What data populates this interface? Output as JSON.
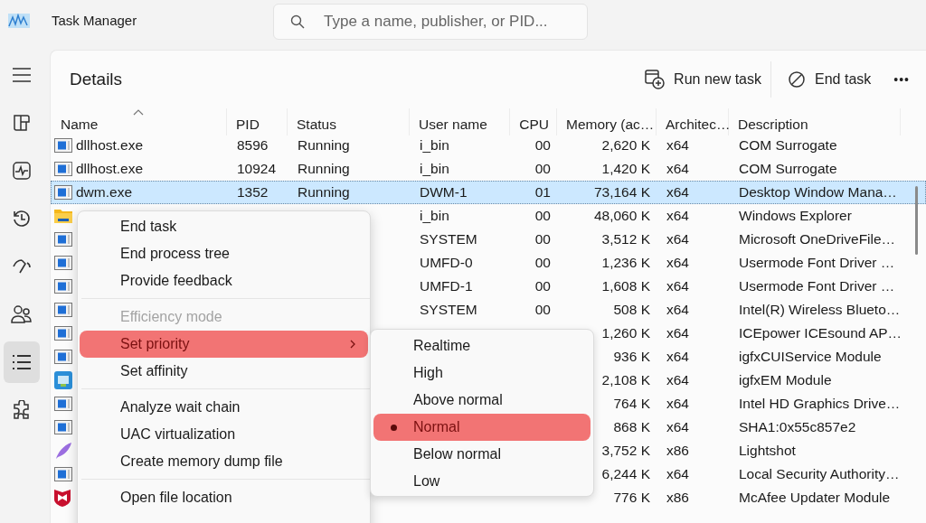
{
  "window": {
    "title": "Task Manager"
  },
  "search": {
    "placeholder": "Type a name, publisher, or PID..."
  },
  "sidebar": {
    "items": [
      {
        "kind": "menu",
        "selected": false
      },
      {
        "kind": "processes",
        "selected": false
      },
      {
        "kind": "performance",
        "selected": false
      },
      {
        "kind": "history",
        "selected": false
      },
      {
        "kind": "startup",
        "selected": false
      },
      {
        "kind": "users",
        "selected": false
      },
      {
        "kind": "details",
        "selected": true
      },
      {
        "kind": "services",
        "selected": false
      }
    ]
  },
  "header": {
    "title": "Details",
    "actions": [
      {
        "kind": "run",
        "label": "Run new task"
      },
      {
        "kind": "end",
        "label": "End task"
      },
      {
        "kind": "more",
        "label": "•••"
      }
    ]
  },
  "table": {
    "columns": [
      {
        "label": "Name",
        "sorted": true
      },
      {
        "label": "PID",
        "sorted": false
      },
      {
        "label": "Status",
        "sorted": false
      },
      {
        "label": "User name",
        "sorted": false
      },
      {
        "label": "CPU",
        "sorted": false
      },
      {
        "label": "Memory (ac…",
        "sorted": false
      },
      {
        "label": "Architec…",
        "sorted": false
      },
      {
        "label": "Description",
        "sorted": false
      }
    ],
    "rows": [
      {
        "kind": "exe",
        "selected": false,
        "cells": [
          "dllhost.exe",
          "8596",
          "Running",
          "i_bin",
          "00",
          "2,620 K",
          "x64",
          "COM Surrogate"
        ]
      },
      {
        "kind": "exe",
        "selected": false,
        "cells": [
          "dllhost.exe",
          "10924",
          "Running",
          "i_bin",
          "00",
          "1,420 K",
          "x64",
          "COM Surrogate"
        ]
      },
      {
        "kind": "exe",
        "selected": true,
        "cells": [
          "dwm.exe",
          "1352",
          "Running",
          "DWM-1",
          "01",
          "73,164 K",
          "x64",
          "Desktop Window Mana…"
        ]
      },
      {
        "kind": "folder",
        "selected": false,
        "cells": [
          null,
          null,
          null,
          "i_bin",
          "00",
          "48,060 K",
          "x64",
          "Windows Explorer"
        ]
      },
      {
        "kind": "exe",
        "selected": false,
        "cells": [
          null,
          null,
          null,
          "SYSTEM",
          "00",
          "3,512 K",
          "x64",
          "Microsoft OneDriveFile…"
        ]
      },
      {
        "kind": "exe",
        "selected": false,
        "cells": [
          null,
          null,
          null,
          "UMFD-0",
          "00",
          "1,236 K",
          "x64",
          "Usermode Font Driver …"
        ]
      },
      {
        "kind": "exe",
        "selected": false,
        "cells": [
          null,
          null,
          null,
          "UMFD-1",
          "00",
          "1,608 K",
          "x64",
          "Usermode Font Driver …"
        ]
      },
      {
        "kind": "exe",
        "selected": false,
        "cells": [
          null,
          null,
          null,
          "SYSTEM",
          "00",
          "508 K",
          "x64",
          "Intel(R) Wireless Blueto…"
        ]
      },
      {
        "kind": "exe",
        "selected": false,
        "cells": [
          null,
          null,
          null,
          null,
          null,
          "1,260 K",
          "x64",
          "ICEpower ICEsound AP…"
        ]
      },
      {
        "kind": "exe",
        "selected": false,
        "cells": [
          null,
          null,
          null,
          null,
          null,
          "936 K",
          "x64",
          "igfxCUIService Module"
        ]
      },
      {
        "kind": "app",
        "selected": false,
        "cells": [
          null,
          null,
          null,
          null,
          null,
          "2,108 K",
          "x64",
          "igfxEM Module"
        ]
      },
      {
        "kind": "exe",
        "selected": false,
        "cells": [
          null,
          null,
          null,
          null,
          null,
          "764 K",
          "x64",
          "Intel HD Graphics Drive…"
        ]
      },
      {
        "kind": "exe",
        "selected": false,
        "cells": [
          null,
          null,
          null,
          null,
          null,
          "868 K",
          "x64",
          "SHA1:0x55c857e2"
        ]
      },
      {
        "kind": "feather",
        "selected": false,
        "cells": [
          null,
          null,
          null,
          null,
          null,
          "3,752 K",
          "x86",
          "Lightshot"
        ]
      },
      {
        "kind": "exe",
        "selected": false,
        "cells": [
          null,
          null,
          null,
          null,
          null,
          "6,244 K",
          "x64",
          "Local Security Authority…"
        ]
      },
      {
        "kind": "shield",
        "selected": false,
        "cells": [
          null,
          null,
          null,
          null,
          null,
          "776 K",
          "x86",
          "McAfee Updater Module"
        ]
      }
    ]
  },
  "context_menu": {
    "groups": [
      [
        {
          "label": "End task",
          "disabled": false,
          "highlighted": false,
          "submenu": false
        },
        {
          "label": "End process tree",
          "disabled": false,
          "highlighted": false,
          "submenu": false
        },
        {
          "label": "Provide feedback",
          "disabled": false,
          "highlighted": false,
          "submenu": false
        }
      ],
      [
        {
          "label": "Efficiency mode",
          "disabled": true,
          "highlighted": false,
          "submenu": false
        },
        {
          "label": "Set priority",
          "disabled": false,
          "highlighted": true,
          "submenu": true
        },
        {
          "label": "Set affinity",
          "disabled": false,
          "highlighted": false,
          "submenu": false
        }
      ],
      [
        {
          "label": "Analyze wait chain",
          "disabled": false,
          "highlighted": false,
          "submenu": false
        },
        {
          "label": "UAC virtualization",
          "disabled": false,
          "highlighted": false,
          "submenu": false
        },
        {
          "label": "Create memory dump file",
          "disabled": false,
          "highlighted": false,
          "submenu": false
        }
      ],
      [
        {
          "label": "Open file location",
          "disabled": false,
          "highlighted": false,
          "submenu": false
        }
      ]
    ]
  },
  "priority_menu": {
    "items": [
      {
        "label": "Realtime",
        "selected": false
      },
      {
        "label": "High",
        "selected": false
      },
      {
        "label": "Above normal",
        "selected": false
      },
      {
        "label": "Normal",
        "selected": true
      },
      {
        "label": "Below normal",
        "selected": false
      },
      {
        "label": "Low",
        "selected": false
      }
    ]
  }
}
